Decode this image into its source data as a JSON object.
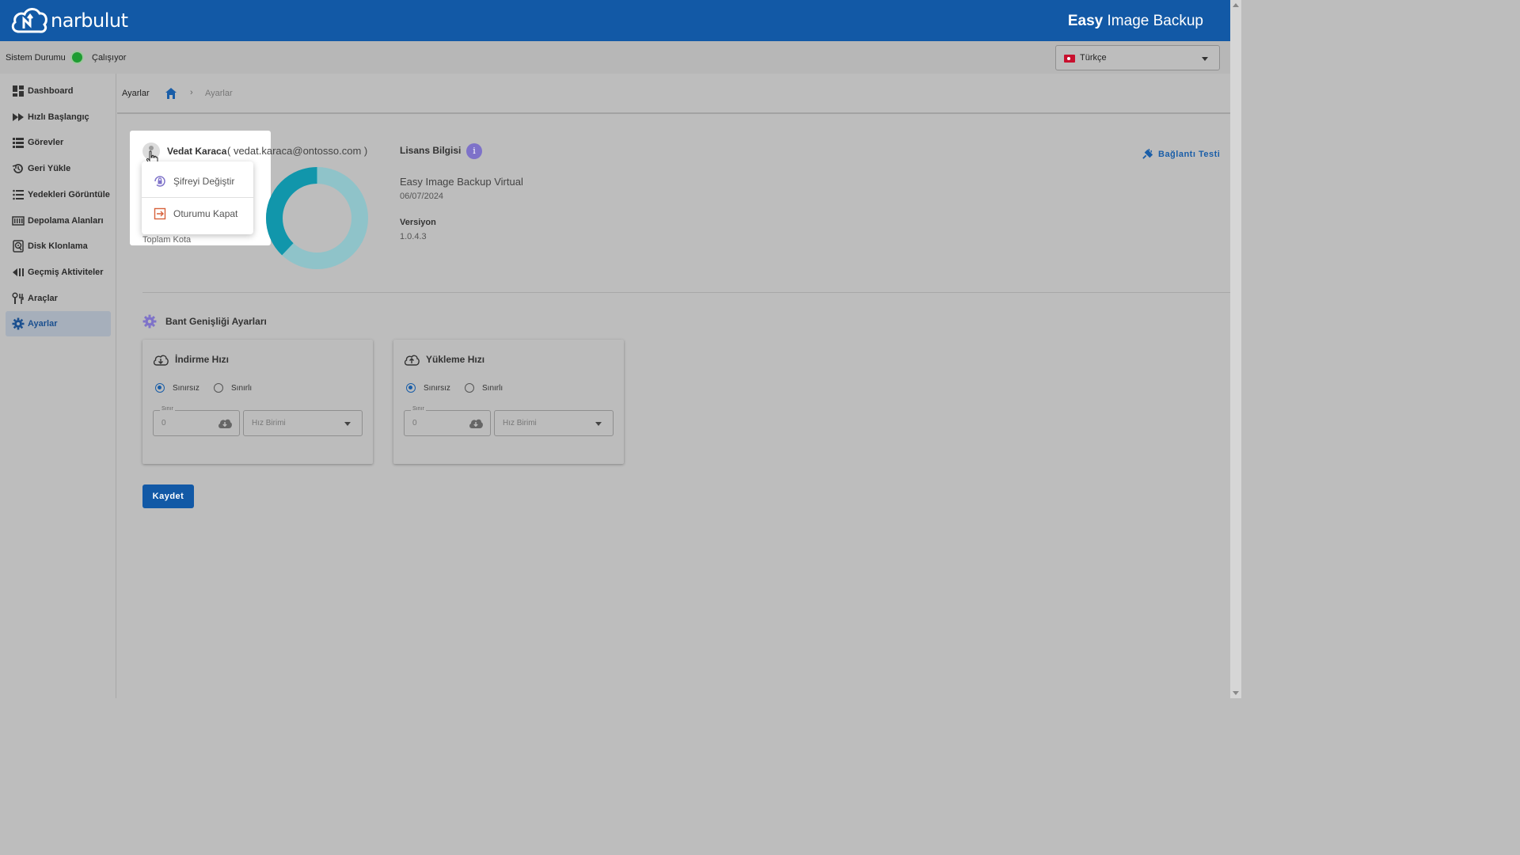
{
  "header": {
    "logo_text": "narbulut",
    "app_title_bold": "Easy",
    "app_title_rest": " Image Backup",
    "brand_color": "#1259a6"
  },
  "status": {
    "label": "Sistem Durumu",
    "value": "Çalışıyor",
    "indicator_color": "#1e9c32"
  },
  "language": {
    "selected": "Türkçe",
    "flag_icon": "turkey-flag-icon"
  },
  "sidebar": {
    "items": [
      {
        "label": "Dashboard",
        "icon": "dashboard-icon"
      },
      {
        "label": "Hızlı Başlangıç",
        "icon": "fast-forward-icon"
      },
      {
        "label": "Görevler",
        "icon": "task-list-icon"
      },
      {
        "label": "Geri Yükle",
        "icon": "restore-icon"
      },
      {
        "label": "Yedekleri Görüntüle",
        "icon": "list-icon"
      },
      {
        "label": "Depolama Alanları",
        "icon": "storage-icon"
      },
      {
        "label": "Disk Klonlama",
        "icon": "disk-clone-icon"
      },
      {
        "label": "Geçmiş Aktiviteler",
        "icon": "history-icon"
      },
      {
        "label": "Araçlar",
        "icon": "tools-icon"
      },
      {
        "label": "Ayarlar",
        "icon": "gear-icon",
        "active": true
      }
    ]
  },
  "breadcrumb": {
    "title": "Ayarlar",
    "home_icon": "home-icon",
    "separator": "›",
    "current": "Ayarlar"
  },
  "user": {
    "name": "Vedat Karaca",
    "email": "( vedat.karaca@ontosso.com )",
    "quota_label": "Toplam Kota",
    "menu": {
      "change_password": "Şifreyi Değiştir",
      "logout": "Oturumu Kapat"
    }
  },
  "license": {
    "title": "Lisans Bilgisi",
    "info_glyph": "i",
    "product": "Easy Image Backup Virtual",
    "date": "06/07/2024",
    "version_label": "Versiyon",
    "version_value": "1.0.4.3"
  },
  "connection_test": {
    "label": "Bağlantı Testi"
  },
  "quota_chart": {
    "used_fraction": 0.38,
    "used_color": "#1196ab",
    "free_color": "#8fc3c9"
  },
  "bandwidth": {
    "title": "Bant Genişliği Ayarları",
    "download": {
      "title": "İndirme Hızı",
      "options": [
        "Sınırsız",
        "Sınırlı"
      ],
      "selected": "Sınırsız",
      "limit_legend": "Sınır",
      "limit_value": "0",
      "unit_placeholder": "Hız Birimi"
    },
    "upload": {
      "title": "Yükleme Hızı",
      "options": [
        "Sınırsız",
        "Sınırlı"
      ],
      "selected": "Sınırsız",
      "limit_legend": "Sınır",
      "limit_value": "0",
      "unit_placeholder": "Hız Birimi"
    }
  },
  "save_label": "Kaydet"
}
